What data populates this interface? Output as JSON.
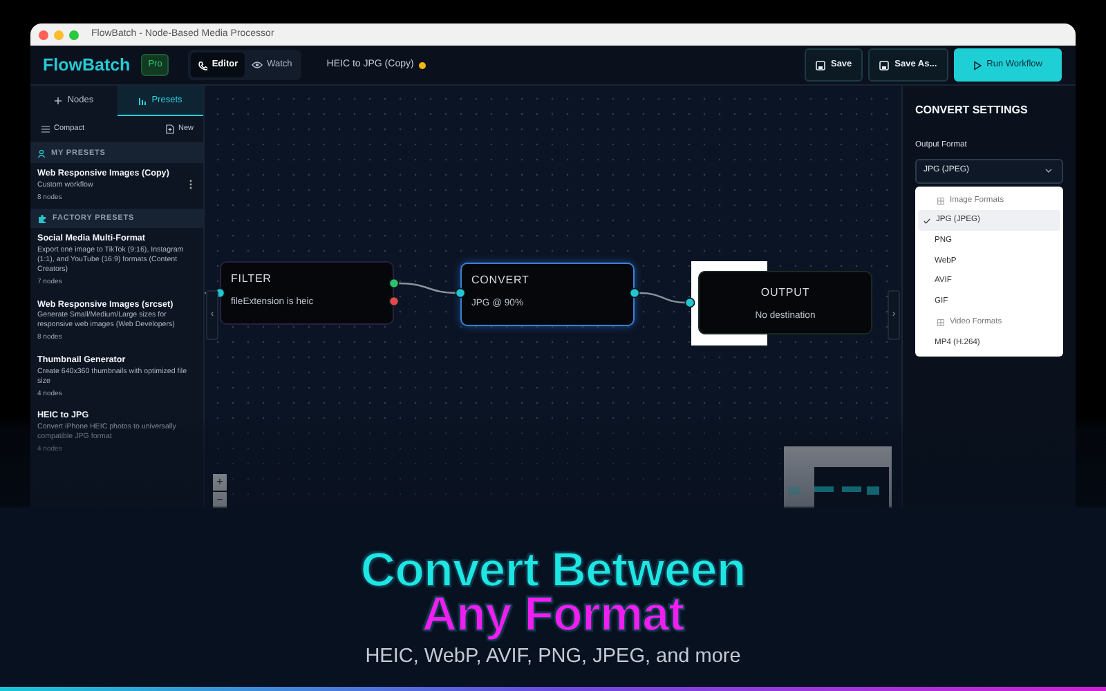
{
  "window": {
    "title": "FlowBatch - Node-Based Media Processor"
  },
  "header": {
    "logo": "FlowBatch",
    "badge": "Pro",
    "modes": [
      {
        "label": "Editor",
        "selected": true
      },
      {
        "label": "Watch",
        "selected": false
      }
    ],
    "workflow_name": "HEIC to JPG (Copy)",
    "unsaved": true,
    "buttons": [
      {
        "label": "Save",
        "kind": "save"
      },
      {
        "label": "Save As...",
        "kind": "save"
      },
      {
        "label": "Run Workflow",
        "kind": "run"
      }
    ]
  },
  "sidebar": {
    "tabs": [
      {
        "label": "Nodes",
        "selected": false
      },
      {
        "label": "Presets",
        "selected": true
      }
    ],
    "view_toggle": "Compact",
    "new_button": "New",
    "sections": [
      {
        "title": "MY PRESETS",
        "kind": "user",
        "items": [
          {
            "name": "Web Responsive Images (Copy)",
            "description": "Custom workflow",
            "count": "8 nodes",
            "has_menu": true
          }
        ]
      },
      {
        "title": "FACTORY PRESETS",
        "kind": "factory",
        "items": [
          {
            "name": "Social Media Multi-Format",
            "description": "Export one image to TikTok (9:16), Instagram (1:1), and YouTube (16:9) formats (Content Creators)",
            "count": "7 nodes",
            "has_menu": false
          },
          {
            "name": "Web Responsive Images (srcset)",
            "description": "Generate Small/Medium/Large sizes for responsive web images (Web Developers)",
            "count": "8 nodes",
            "has_menu": false
          },
          {
            "name": "Thumbnail Generator",
            "description": "Create 640x360 thumbnails with optimized file size",
            "count": "4 nodes",
            "has_menu": false
          },
          {
            "name": "HEIC to JPG",
            "description": "Convert iPhone HEIC photos to universally compatible JPG format",
            "count": "4 nodes",
            "has_menu": false
          }
        ]
      }
    ]
  },
  "canvas": {
    "nodes": [
      {
        "kind": "filter",
        "title": "FILTER",
        "subtitle": "fileExtension is heic",
        "selected": false
      },
      {
        "kind": "convert",
        "title": "CONVERT",
        "subtitle": "JPG @ 90%",
        "selected": true
      },
      {
        "kind": "output",
        "title": "OUTPUT",
        "subtitle": "No destination",
        "selected": false
      }
    ],
    "zoom_in": "+",
    "zoom_out": "−",
    "collapse_left": "‹",
    "collapse_right": "›"
  },
  "settings": {
    "title": "CONVERT SETTINGS",
    "field_label": "Output Format",
    "value": "JPG (JPEG)",
    "expanded": true,
    "options": [
      {
        "kind": "group",
        "label": "Image Formats"
      },
      {
        "kind": "option",
        "label": "JPG (JPEG)",
        "selected": true
      },
      {
        "kind": "option",
        "label": "PNG",
        "selected": false
      },
      {
        "kind": "option",
        "label": "WebP",
        "selected": false
      },
      {
        "kind": "option",
        "label": "AVIF",
        "selected": false
      },
      {
        "kind": "option",
        "label": "GIF",
        "selected": false
      },
      {
        "kind": "group",
        "label": "Video Formats"
      },
      {
        "kind": "option",
        "label": "MP4 (H.264)",
        "selected": false
      }
    ]
  },
  "banner": {
    "lines": [
      {
        "text": "Convert Between",
        "color": "#1ee6e3"
      },
      {
        "text": "Any Format",
        "color": "#f01ef0"
      }
    ],
    "subtitle": "HEIC, WebP, AVIF, PNG, JPEG, and more"
  }
}
